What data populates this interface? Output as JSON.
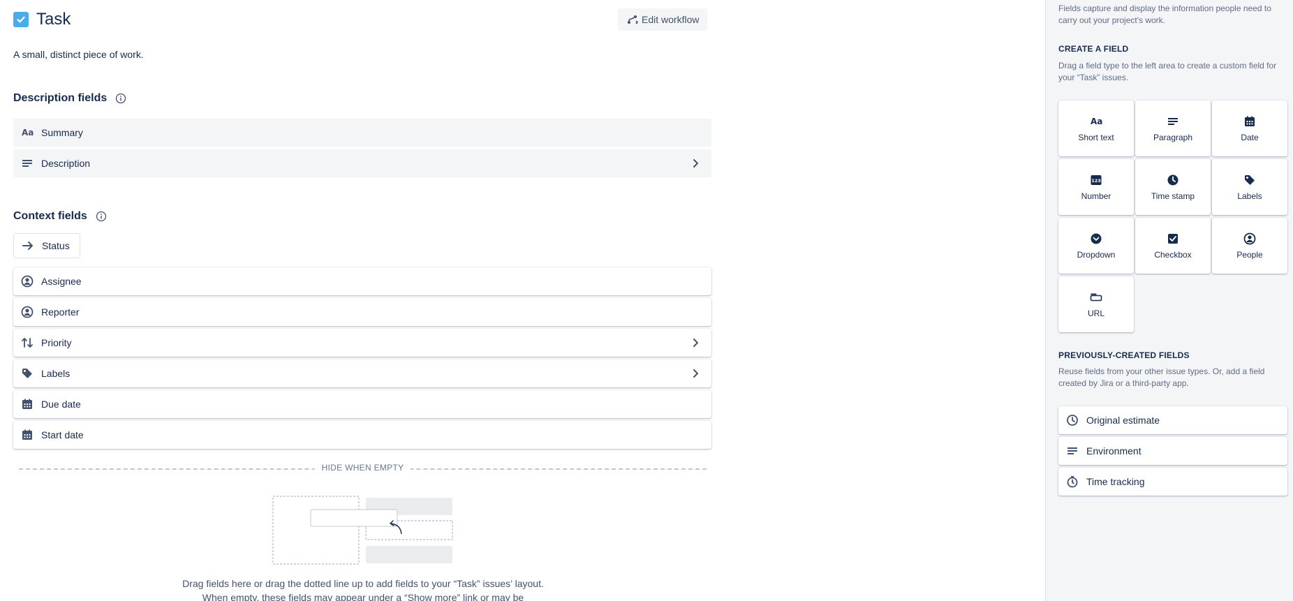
{
  "issue_type": {
    "title": "Task",
    "description": "A small, distinct piece of work.",
    "icon": "checkbox-checked-icon",
    "color": "#4bade8"
  },
  "toolbar": {
    "edit_workflow_label": "Edit workflow"
  },
  "description_fields": {
    "title": "Description fields",
    "items": [
      {
        "label": "Summary",
        "icon": "text-aa-icon",
        "has_chevron": false
      },
      {
        "label": "Description",
        "icon": "paragraph-icon",
        "has_chevron": true
      }
    ]
  },
  "context_fields": {
    "title": "Context fields",
    "status_label": "Status",
    "items": [
      {
        "label": "Assignee",
        "icon": "person-circle-icon",
        "has_chevron": false
      },
      {
        "label": "Reporter",
        "icon": "person-circle-icon",
        "has_chevron": false
      },
      {
        "label": "Priority",
        "icon": "priority-arrows-icon",
        "has_chevron": true
      },
      {
        "label": "Labels",
        "icon": "tag-icon",
        "has_chevron": true
      },
      {
        "label": "Due date",
        "icon": "calendar-icon",
        "has_chevron": false
      },
      {
        "label": "Start date",
        "icon": "calendar-icon",
        "has_chevron": false
      }
    ]
  },
  "hide_when_empty": {
    "label": "HIDE WHEN EMPTY",
    "help_text": "Drag fields here or drag the dotted line up to add fields to your “Task” issues’ layout. When empty, these fields may appear under a “Show more” link or may be"
  },
  "sidebar": {
    "intro": "Fields capture and display the information people need to carry out your project's work.",
    "create": {
      "heading": "CREATE A FIELD",
      "text": "Drag a field type to the left area to create a custom field for your “Task” issues.",
      "types": [
        {
          "label": "Short text",
          "icon": "text-aa-icon"
        },
        {
          "label": "Paragraph",
          "icon": "paragraph-icon"
        },
        {
          "label": "Date",
          "icon": "calendar-icon"
        },
        {
          "label": "Number",
          "icon": "number-123-icon"
        },
        {
          "label": "Time stamp",
          "icon": "clock-icon"
        },
        {
          "label": "Labels",
          "icon": "tag-icon"
        },
        {
          "label": "Dropdown",
          "icon": "dropdown-circle-icon"
        },
        {
          "label": "Checkbox",
          "icon": "checkbox-icon"
        },
        {
          "label": "People",
          "icon": "person-circle-icon"
        },
        {
          "label": "URL",
          "icon": "link-icon"
        }
      ]
    },
    "previous": {
      "heading": "PREVIOUSLY-CREATED FIELDS",
      "text": "Reuse fields from your other issue types. Or, add a field created by Jira or a third-party app.",
      "items": [
        {
          "label": "Original estimate",
          "icon": "clock-outline-icon"
        },
        {
          "label": "Environment",
          "icon": "paragraph-icon"
        },
        {
          "label": "Time tracking",
          "icon": "stopwatch-icon"
        }
      ]
    }
  }
}
